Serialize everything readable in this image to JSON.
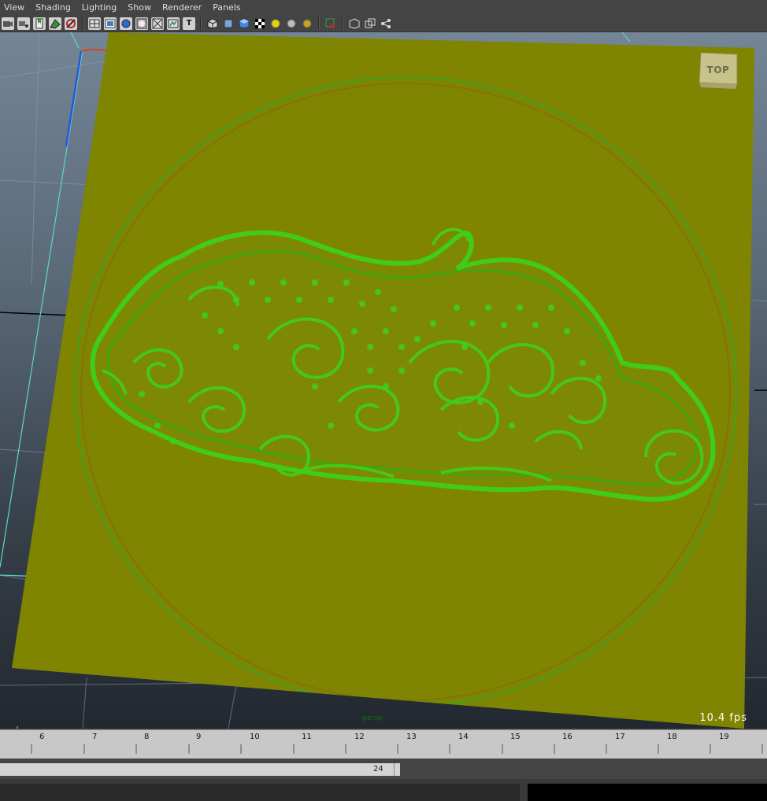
{
  "menu": {
    "items": [
      {
        "label": "View"
      },
      {
        "label": "Shading"
      },
      {
        "label": "Lighting"
      },
      {
        "label": "Show"
      },
      {
        "label": "Renderer"
      },
      {
        "label": "Panels"
      }
    ]
  },
  "toolbar": {
    "icons": [
      "camera-icon",
      "camera-attributes-icon",
      "bookmark-icon",
      "image-plane-icon",
      "grid-toggle-icon",
      "wireframe-icon",
      "smooth-shade-icon",
      "textured-icon",
      "xray-icon",
      "shadows-icon",
      "isolate-icon",
      "text-icon",
      "cube-icon",
      "shaded-cube-icon",
      "blue-cube-icon",
      "checker-icon",
      "yellow-sphere-icon",
      "grey-sphere-icon",
      "gold-sphere-icon",
      "select-icon",
      "box-icon",
      "two-boxes-icon",
      "share-icon"
    ],
    "text_icon_glyph": "T"
  },
  "viewport": {
    "fps": "10.4 fps",
    "camera_label": "persp",
    "viewcube_label": "TOP",
    "surface_color": "#7f8500",
    "relief_color": "#39c71a",
    "grid_axis_color": "#5cd7c8"
  },
  "timeline": {
    "ticks": [
      "6",
      "7",
      "8",
      "9",
      "10",
      "11",
      "12",
      "13",
      "14",
      "15",
      "16",
      "17",
      "18",
      "19"
    ]
  },
  "range": {
    "end_value": "24"
  }
}
